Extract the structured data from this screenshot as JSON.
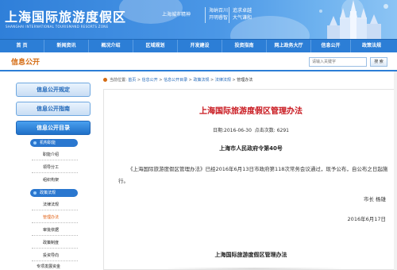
{
  "brand": {
    "title": "上海国际旅游度假区",
    "subtitle": "SHANGHAI INTERNATIONAL TOURISMAND RESORTS ZONE",
    "spirit_label": "上海城市精神",
    "slogan_left": [
      "海纳百川",
      "开明睿智"
    ],
    "slogan_right": [
      "追求卓越",
      "大气谦和"
    ]
  },
  "nav": {
    "items": [
      "首 页",
      "新闻资讯",
      "概况介绍",
      "区域规划",
      "开发建设",
      "投资指南",
      "网上政务大厅",
      "信息公开",
      "政策法规"
    ]
  },
  "sub_header": {
    "section_title": "信息公开",
    "search_placeholder": "请输入关键字",
    "search_button": "搜 索"
  },
  "sidebar": {
    "buttons": [
      "信息公开规定",
      "信息公开指南",
      "信息公开目录"
    ],
    "groups": [
      "机构职能",
      "政策法规"
    ],
    "org_links": [
      "职能介绍",
      "领导分工",
      "组织构架"
    ],
    "policy_links": [
      "法律法规",
      "管理办法",
      "审批依据",
      "政策制度",
      "投资导向",
      "专项发展资金"
    ]
  },
  "breadcrumb": {
    "prefix": "当前位置:",
    "items": [
      "首页",
      "信息公开",
      "信息公开目录",
      "政策法规",
      "法律法规",
      "管理办法"
    ],
    "sep": " > "
  },
  "article": {
    "title": "上海国际旅游度假区管理办法",
    "date_label": "日期:",
    "date": "2016-06-30",
    "clicks_label": "点击次数:",
    "clicks": "6291",
    "order_no_prefix": "上海市人民政府令第",
    "order_no_num": "40",
    "order_no_suffix": "号",
    "paragraph1": "《上海国际旅游度假区管理办法》已经2016年6月13日市政府第118次常务会议通过，现予公布，自公布之日起施行。",
    "signature": "市长 杨雄",
    "sign_date": "2016年6月17日",
    "rule_title": "上海国际旅游度假区管理办法"
  },
  "colors": {
    "nav_blue": "#2c7ed6",
    "title_red": "#c8161d",
    "section_orange": "#d46a11",
    "active_link": "#e05b0c"
  }
}
